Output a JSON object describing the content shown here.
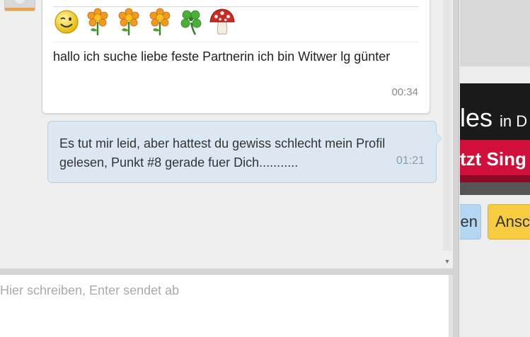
{
  "message_in": {
    "emojis": [
      "smiley-icon",
      "flower-icon",
      "flower-icon",
      "flower-icon",
      "clover-icon",
      "mushroom-icon"
    ],
    "text": "hallo ich suche liebe feste Partnerin ich bin Witwer lg günter",
    "time": "00:34"
  },
  "message_out": {
    "text": "Es tut mir leid, aber hattest du gewiss schlecht mein Profil gelesen, Punkt #8 gerade fuer Dich...........",
    "time": "01:21"
  },
  "input": {
    "placeholder": "Hier schreiben, Enter sendet ab",
    "value": ""
  },
  "sidebar": {
    "banner_headline": "les",
    "banner_headline_suffix": "in D",
    "banner_button": "tzt Sing",
    "button_blue": "en",
    "button_yellow": "Ansc"
  },
  "colors": {
    "bubble_out_bg": "#dbe8f2",
    "banner_red": "#d0103a",
    "button_blue": "#b3d7f2",
    "button_yellow": "#f8cc40"
  }
}
